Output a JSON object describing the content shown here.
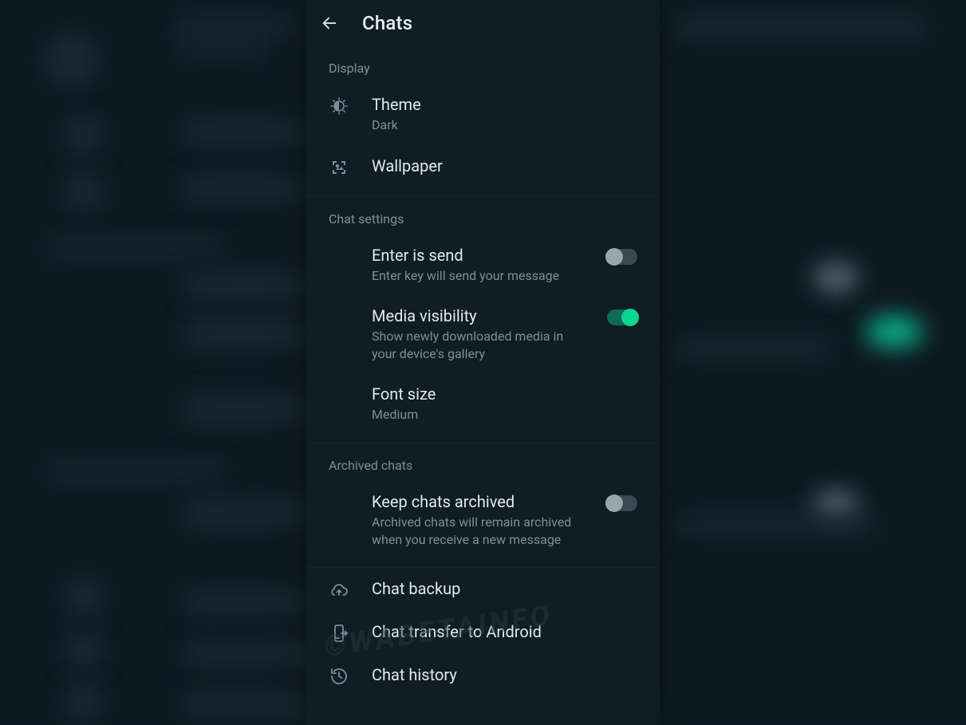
{
  "header": {
    "title": "Chats"
  },
  "sections": {
    "display": {
      "header": "Display",
      "theme": {
        "label": "Theme",
        "value": "Dark"
      },
      "wallpaper": {
        "label": "Wallpaper"
      }
    },
    "chatSettings": {
      "header": "Chat settings",
      "enterIsSend": {
        "label": "Enter is send",
        "sub": "Enter key will send your message",
        "on": false
      },
      "mediaVisibility": {
        "label": "Media visibility",
        "sub": "Show newly downloaded media in your device's gallery",
        "on": true
      },
      "fontSize": {
        "label": "Font size",
        "value": "Medium"
      }
    },
    "archived": {
      "header": "Archived chats",
      "keepArchived": {
        "label": "Keep chats archived",
        "sub": "Archived chats will remain archived when you receive a new message",
        "on": false
      }
    },
    "more": {
      "chatBackup": {
        "label": "Chat backup"
      },
      "chatTransfer": {
        "label": "Chat transfer to Android"
      },
      "chatHistory": {
        "label": "Chat history"
      }
    }
  },
  "watermark": "©WABETAINFO"
}
